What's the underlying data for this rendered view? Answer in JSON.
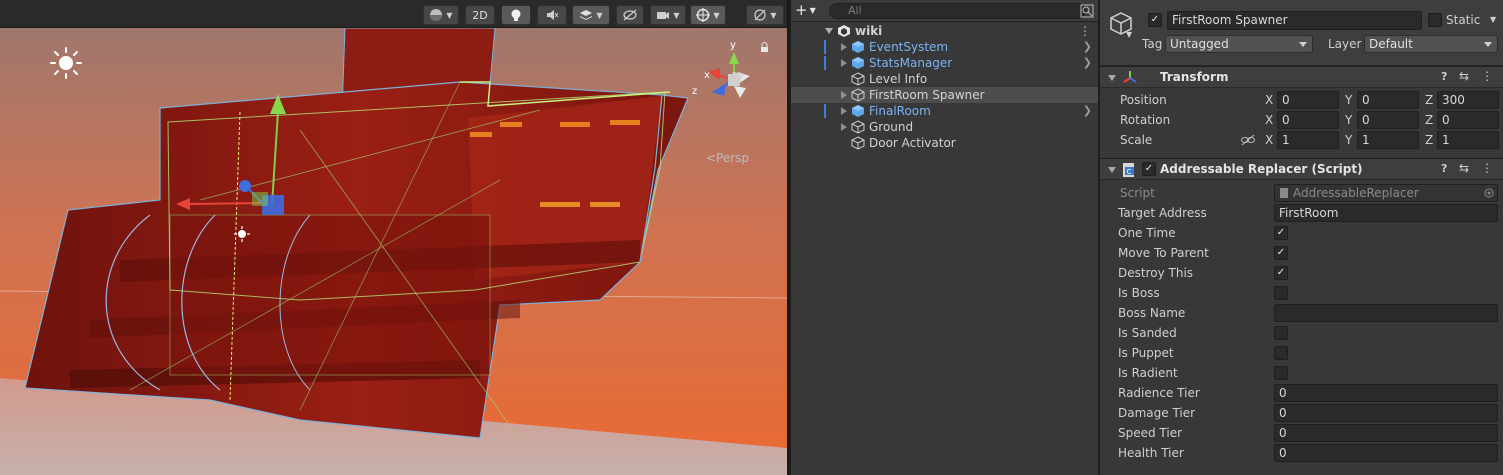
{
  "scene": {
    "toolbar": {
      "btn_2d": "2D"
    },
    "persp_label": "<Persp",
    "gizmo_axes": {
      "x": "x",
      "y": "y",
      "z": "z"
    }
  },
  "hierarchy": {
    "search_placeholder": "All",
    "root": "wiki",
    "items": [
      {
        "label": "EventSystem",
        "type": "prefab",
        "expandable": true,
        "arrow": true
      },
      {
        "label": "StatsManager",
        "type": "prefab",
        "expandable": true,
        "arrow": true
      },
      {
        "label": "Level Info",
        "type": "object",
        "expandable": false,
        "arrow": false
      },
      {
        "label": "FirstRoom Spawner",
        "type": "object",
        "expandable": true,
        "arrow": false,
        "selected": true
      },
      {
        "label": "FinalRoom",
        "type": "prefab",
        "expandable": true,
        "arrow": true
      },
      {
        "label": "Ground",
        "type": "object",
        "expandable": true,
        "arrow": false
      },
      {
        "label": "Door Activator",
        "type": "object",
        "expandable": false,
        "arrow": false
      }
    ]
  },
  "inspector": {
    "object_name": "FirstRoom Spawner",
    "static_label": "Static",
    "tag_label": "Tag",
    "tag_value": "Untagged",
    "layer_label": "Layer",
    "layer_value": "Default",
    "transform": {
      "title": "Transform",
      "position_label": "Position",
      "rotation_label": "Rotation",
      "scale_label": "Scale",
      "position": {
        "x": "0",
        "y": "0",
        "z": "300"
      },
      "rotation": {
        "x": "0",
        "y": "0",
        "z": "0"
      },
      "scale": {
        "x": "1",
        "y": "1",
        "z": "1"
      },
      "axis": {
        "x": "X",
        "y": "Y",
        "z": "Z"
      }
    },
    "script_component": {
      "title": "Addressable Replacer (Script)",
      "script_label": "Script",
      "script_value": "AddressableReplacer",
      "props": [
        {
          "label": "Target Address",
          "kind": "text",
          "value": "FirstRoom"
        },
        {
          "label": "One Time",
          "kind": "bool",
          "value": true
        },
        {
          "label": "Move To Parent",
          "kind": "bool",
          "value": true
        },
        {
          "label": "Destroy This",
          "kind": "bool",
          "value": true
        },
        {
          "label": "Is Boss",
          "kind": "bool",
          "value": false
        },
        {
          "label": "Boss Name",
          "kind": "text",
          "value": ""
        },
        {
          "label": "Is Sanded",
          "kind": "bool",
          "value": false
        },
        {
          "label": "Is Puppet",
          "kind": "bool",
          "value": false
        },
        {
          "label": "Is Radient",
          "kind": "bool",
          "value": false
        },
        {
          "label": "Radience Tier",
          "kind": "text",
          "value": "0"
        },
        {
          "label": "Damage Tier",
          "kind": "text",
          "value": "0"
        },
        {
          "label": "Speed Tier",
          "kind": "text",
          "value": "0"
        },
        {
          "label": "Health Tier",
          "kind": "text",
          "value": "0"
        }
      ]
    }
  },
  "colors": {
    "prefab_text": "#7bb3f2",
    "sky_top": "#b87565",
    "sky_bottom": "#e4683a",
    "floor": "#caa7a0",
    "room_red": "#8a1a12",
    "gizmo_green": "#7ed14a",
    "gizmo_red": "#e8443a",
    "gizmo_blue": "#3e6de0"
  }
}
